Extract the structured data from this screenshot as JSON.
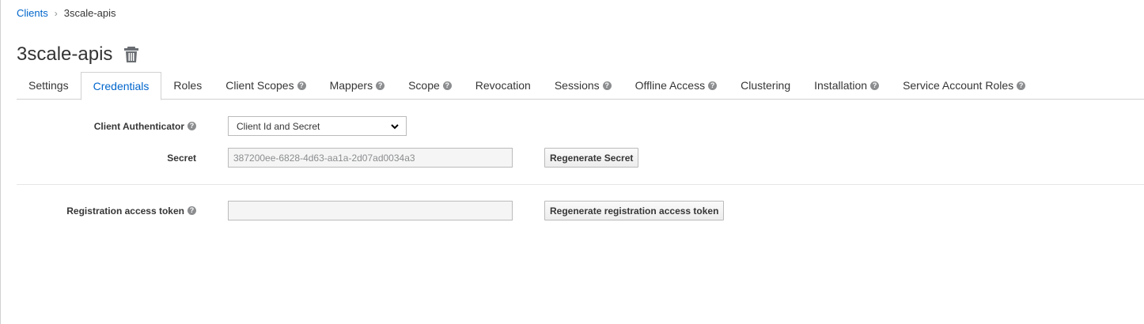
{
  "breadcrumb": {
    "parent": "Clients",
    "current": "3scale-apis"
  },
  "page": {
    "title": "3scale-apis"
  },
  "tabs": [
    {
      "label": "Settings",
      "help": false,
      "active": false
    },
    {
      "label": "Credentials",
      "help": false,
      "active": true
    },
    {
      "label": "Roles",
      "help": false,
      "active": false
    },
    {
      "label": "Client Scopes",
      "help": true,
      "active": false
    },
    {
      "label": "Mappers",
      "help": true,
      "active": false
    },
    {
      "label": "Scope",
      "help": true,
      "active": false
    },
    {
      "label": "Revocation",
      "help": false,
      "active": false
    },
    {
      "label": "Sessions",
      "help": true,
      "active": false
    },
    {
      "label": "Offline Access",
      "help": true,
      "active": false
    },
    {
      "label": "Clustering",
      "help": false,
      "active": false
    },
    {
      "label": "Installation",
      "help": true,
      "active": false
    },
    {
      "label": "Service Account Roles",
      "help": true,
      "active": false
    }
  ],
  "form": {
    "client_authenticator_label": "Client Authenticator",
    "client_authenticator_value": "Client Id and Secret",
    "secret_label": "Secret",
    "secret_value": "387200ee-6828-4d63-aa1a-2d07ad0034a3",
    "regenerate_secret_label": "Regenerate Secret",
    "registration_token_label": "Registration access token",
    "registration_token_value": "",
    "regenerate_token_label": "Regenerate registration access token"
  },
  "colors": {
    "link": "#0066cc",
    "border": "#d1d1d1",
    "help_icon": "#8b8d8f"
  }
}
